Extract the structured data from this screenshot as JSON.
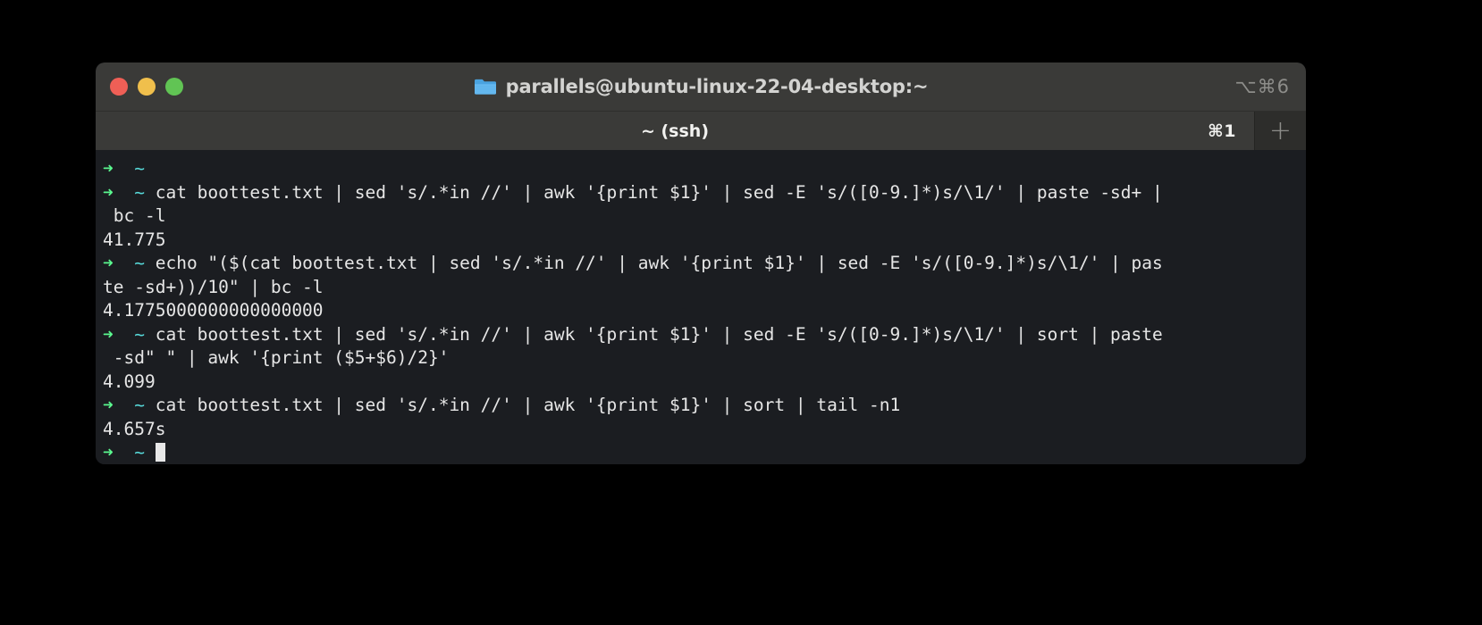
{
  "window": {
    "title": "parallels@ubuntu-linux-22-04-desktop:~",
    "folder_icon": "folder-icon",
    "shortcut": "⌥⌘6",
    "traffic_lights": {
      "close": "close-button",
      "minimize": "minimize-button",
      "zoom": "zoom-button"
    },
    "colors": {
      "titlebar_bg": "#3a3a38",
      "tabbar_bg": "#2d2d2b",
      "terminal_bg": "#1b1d21",
      "text": "#d9d9d9",
      "prompt_arrow": "#5af78e",
      "prompt_path": "#57d9d9",
      "close": "#ef5f56",
      "minimize": "#f0bf4c",
      "zoom": "#61c454"
    }
  },
  "tabbar": {
    "active_tab_label": "~ (ssh)",
    "active_tab_shortcut": "⌘1",
    "new_tab_label": "+"
  },
  "terminal": {
    "prompt_arrow": "➜",
    "prompt_path": "~",
    "cursor": "block-cursor",
    "lines": [
      {
        "type": "prompt",
        "command": ""
      },
      {
        "type": "prompt",
        "command": "cat boottest.txt | sed 's/.*in //' | awk '{print $1}' | sed -E 's/([0-9.]*)s/\\1/' | paste -sd+ |"
      },
      {
        "type": "wrap",
        "command": " bc -l"
      },
      {
        "type": "output",
        "command": "41.775"
      },
      {
        "type": "prompt",
        "command": "echo \"($(cat boottest.txt | sed 's/.*in //' | awk '{print $1}' | sed -E 's/([0-9.]*)s/\\1/' | pas"
      },
      {
        "type": "wrap",
        "command": "te -sd+))/10\" | bc -l"
      },
      {
        "type": "output",
        "command": "4.1775000000000000000"
      },
      {
        "type": "prompt",
        "command": "cat boottest.txt | sed 's/.*in //' | awk '{print $1}' | sed -E 's/([0-9.]*)s/\\1/' | sort | paste"
      },
      {
        "type": "wrap",
        "command": " -sd\" \" | awk '{print ($5+$6)/2}'"
      },
      {
        "type": "output",
        "command": "4.099"
      },
      {
        "type": "prompt",
        "command": "cat boottest.txt | sed 's/.*in //' | awk '{print $1}' | sort | tail -n1"
      },
      {
        "type": "output",
        "command": "4.657s"
      },
      {
        "type": "cursor",
        "command": ""
      }
    ]
  }
}
